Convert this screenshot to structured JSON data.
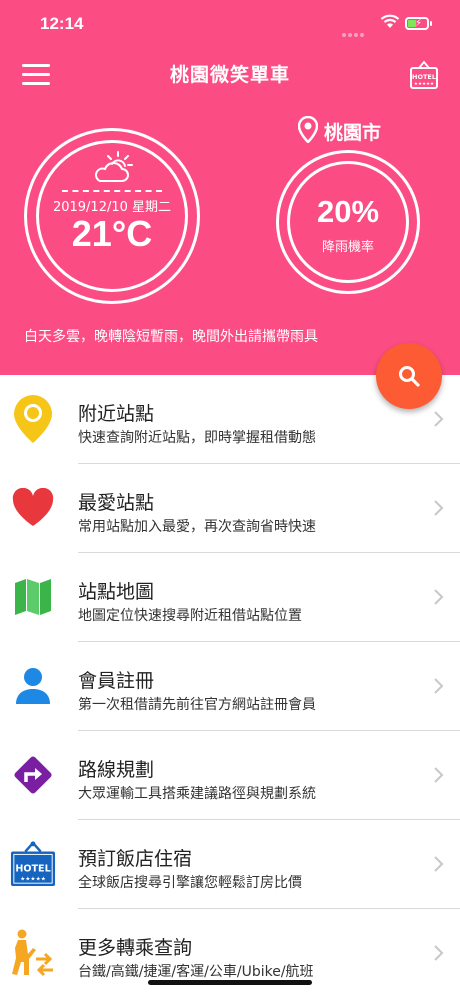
{
  "status_bar": {
    "time": "12:14"
  },
  "header": {
    "title": "桃園微笑單車",
    "menu_icon": "hamburger-menu-icon",
    "hotel_icon": "hotel-sign-icon",
    "accent_color": "#fb4d83"
  },
  "weather": {
    "icon": "partly-cloudy-icon",
    "date": "2019/12/10 星期二",
    "temperature": "21°C",
    "forecast_text": "白天多雲，晚轉陰短暫雨，晚間外出請攜帶雨具"
  },
  "location": {
    "city": "桃園市",
    "icon": "map-pin-icon"
  },
  "rain": {
    "percent": "20%",
    "label": "降雨機率"
  },
  "search_button": {
    "icon": "search-icon",
    "color": "#fd5b33"
  },
  "menu_items": [
    {
      "title": "附近站點",
      "description": "快速查詢附近站點，即時掌握租借動態",
      "icon": "location-pin-icon"
    },
    {
      "title": "最愛站點",
      "description": "常用站點加入最愛，再次查詢省時快速",
      "icon": "heart-icon"
    },
    {
      "title": "站點地圖",
      "description": "地圖定位快速搜尋附近租借站點位置",
      "icon": "map-icon"
    },
    {
      "title": "會員註冊",
      "description": "第一次租借請先前往官方網站註冊會員",
      "icon": "user-icon"
    },
    {
      "title": "路線規劃",
      "description": "大眾運輸工具搭乘建議路徑與規劃系統",
      "icon": "directions-icon"
    },
    {
      "title": "預訂飯店住宿",
      "description": "全球飯店搜尋引擎讓您輕鬆訂房比價",
      "icon": "hotel-icon"
    },
    {
      "title": "更多轉乘查詢",
      "description": "台鐵/高鐵/捷運/客運/公車/Ubike/航班",
      "icon": "transfer-icon"
    }
  ],
  "hotel_sign_text": "HOTEL",
  "hotel_stars": "★★★★★"
}
